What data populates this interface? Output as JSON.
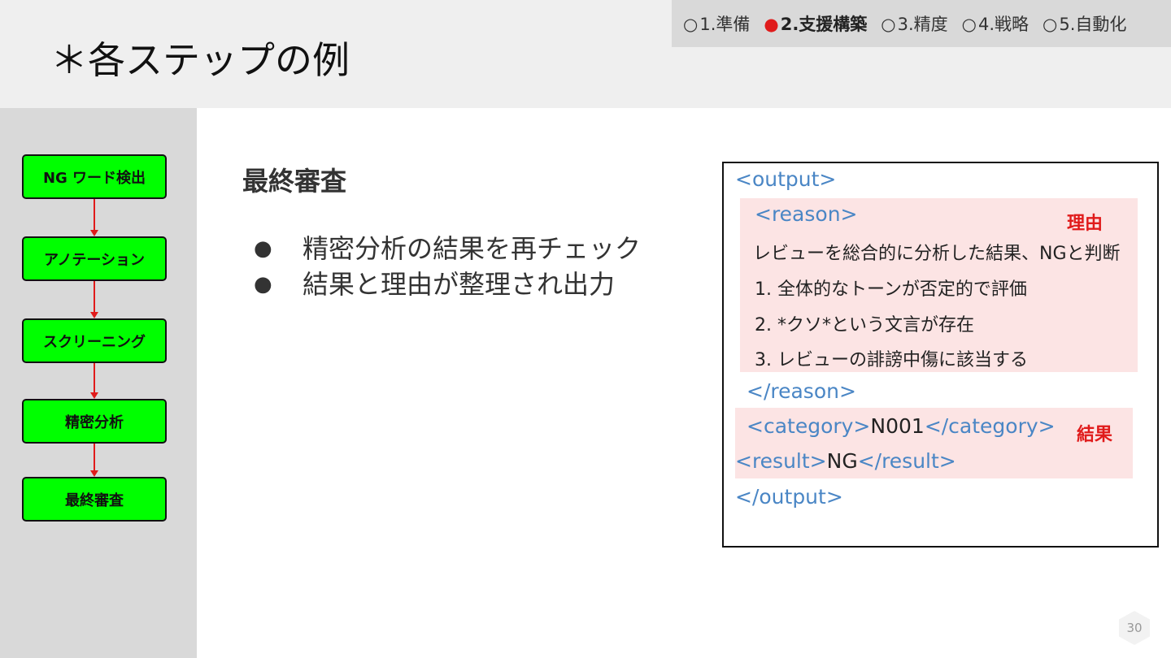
{
  "header": {
    "title": "＊各ステップの例",
    "steps": [
      {
        "mark": "○",
        "label": "1.準備"
      },
      {
        "mark": "●",
        "label": "2.支援構築"
      },
      {
        "mark": "○",
        "label": "3.精度"
      },
      {
        "mark": "○",
        "label": "4.戦略"
      },
      {
        "mark": "○",
        "label": "5.自動化"
      }
    ],
    "active_step": 2
  },
  "flow": {
    "steps": [
      "NG ワード検出",
      "アノテーション",
      "スクリーニング",
      "精密分析",
      "最終審査"
    ]
  },
  "content": {
    "title": "最終審査",
    "bullet_mark": "●",
    "bullets": [
      "精密分析の結果を再チェック",
      "結果と理由が整理され出力"
    ]
  },
  "code": {
    "output_open": "<output>",
    "reason_open": "<reason>",
    "reason_label": "理由",
    "reason_lines": [
      "レビューを総合的に分析した結果、NGと判断",
      "1. 全体的なトーンが否定的で評価",
      "2. *クソ*という文言が存在",
      "3. レビューの誹謗中傷に該当する"
    ],
    "reason_close": "</reason>",
    "category_open": "<category>",
    "category_value": "N001",
    "category_close": "</category>",
    "result_label": "結果",
    "result_open": "<result>",
    "result_value": "NG",
    "result_close": "</result>",
    "output_close": "</output>"
  },
  "page_number": "30",
  "colors": {
    "header_bg": "#efefef",
    "nav_bg": "#d9d9d9",
    "sidebar_bg": "#d9d9d9",
    "flow_box": "#00ff00",
    "arrow": "#e01b1b",
    "active_marker": "#e01b1b",
    "code_tag": "#4a86c5",
    "highlight": "#fce4e4"
  }
}
